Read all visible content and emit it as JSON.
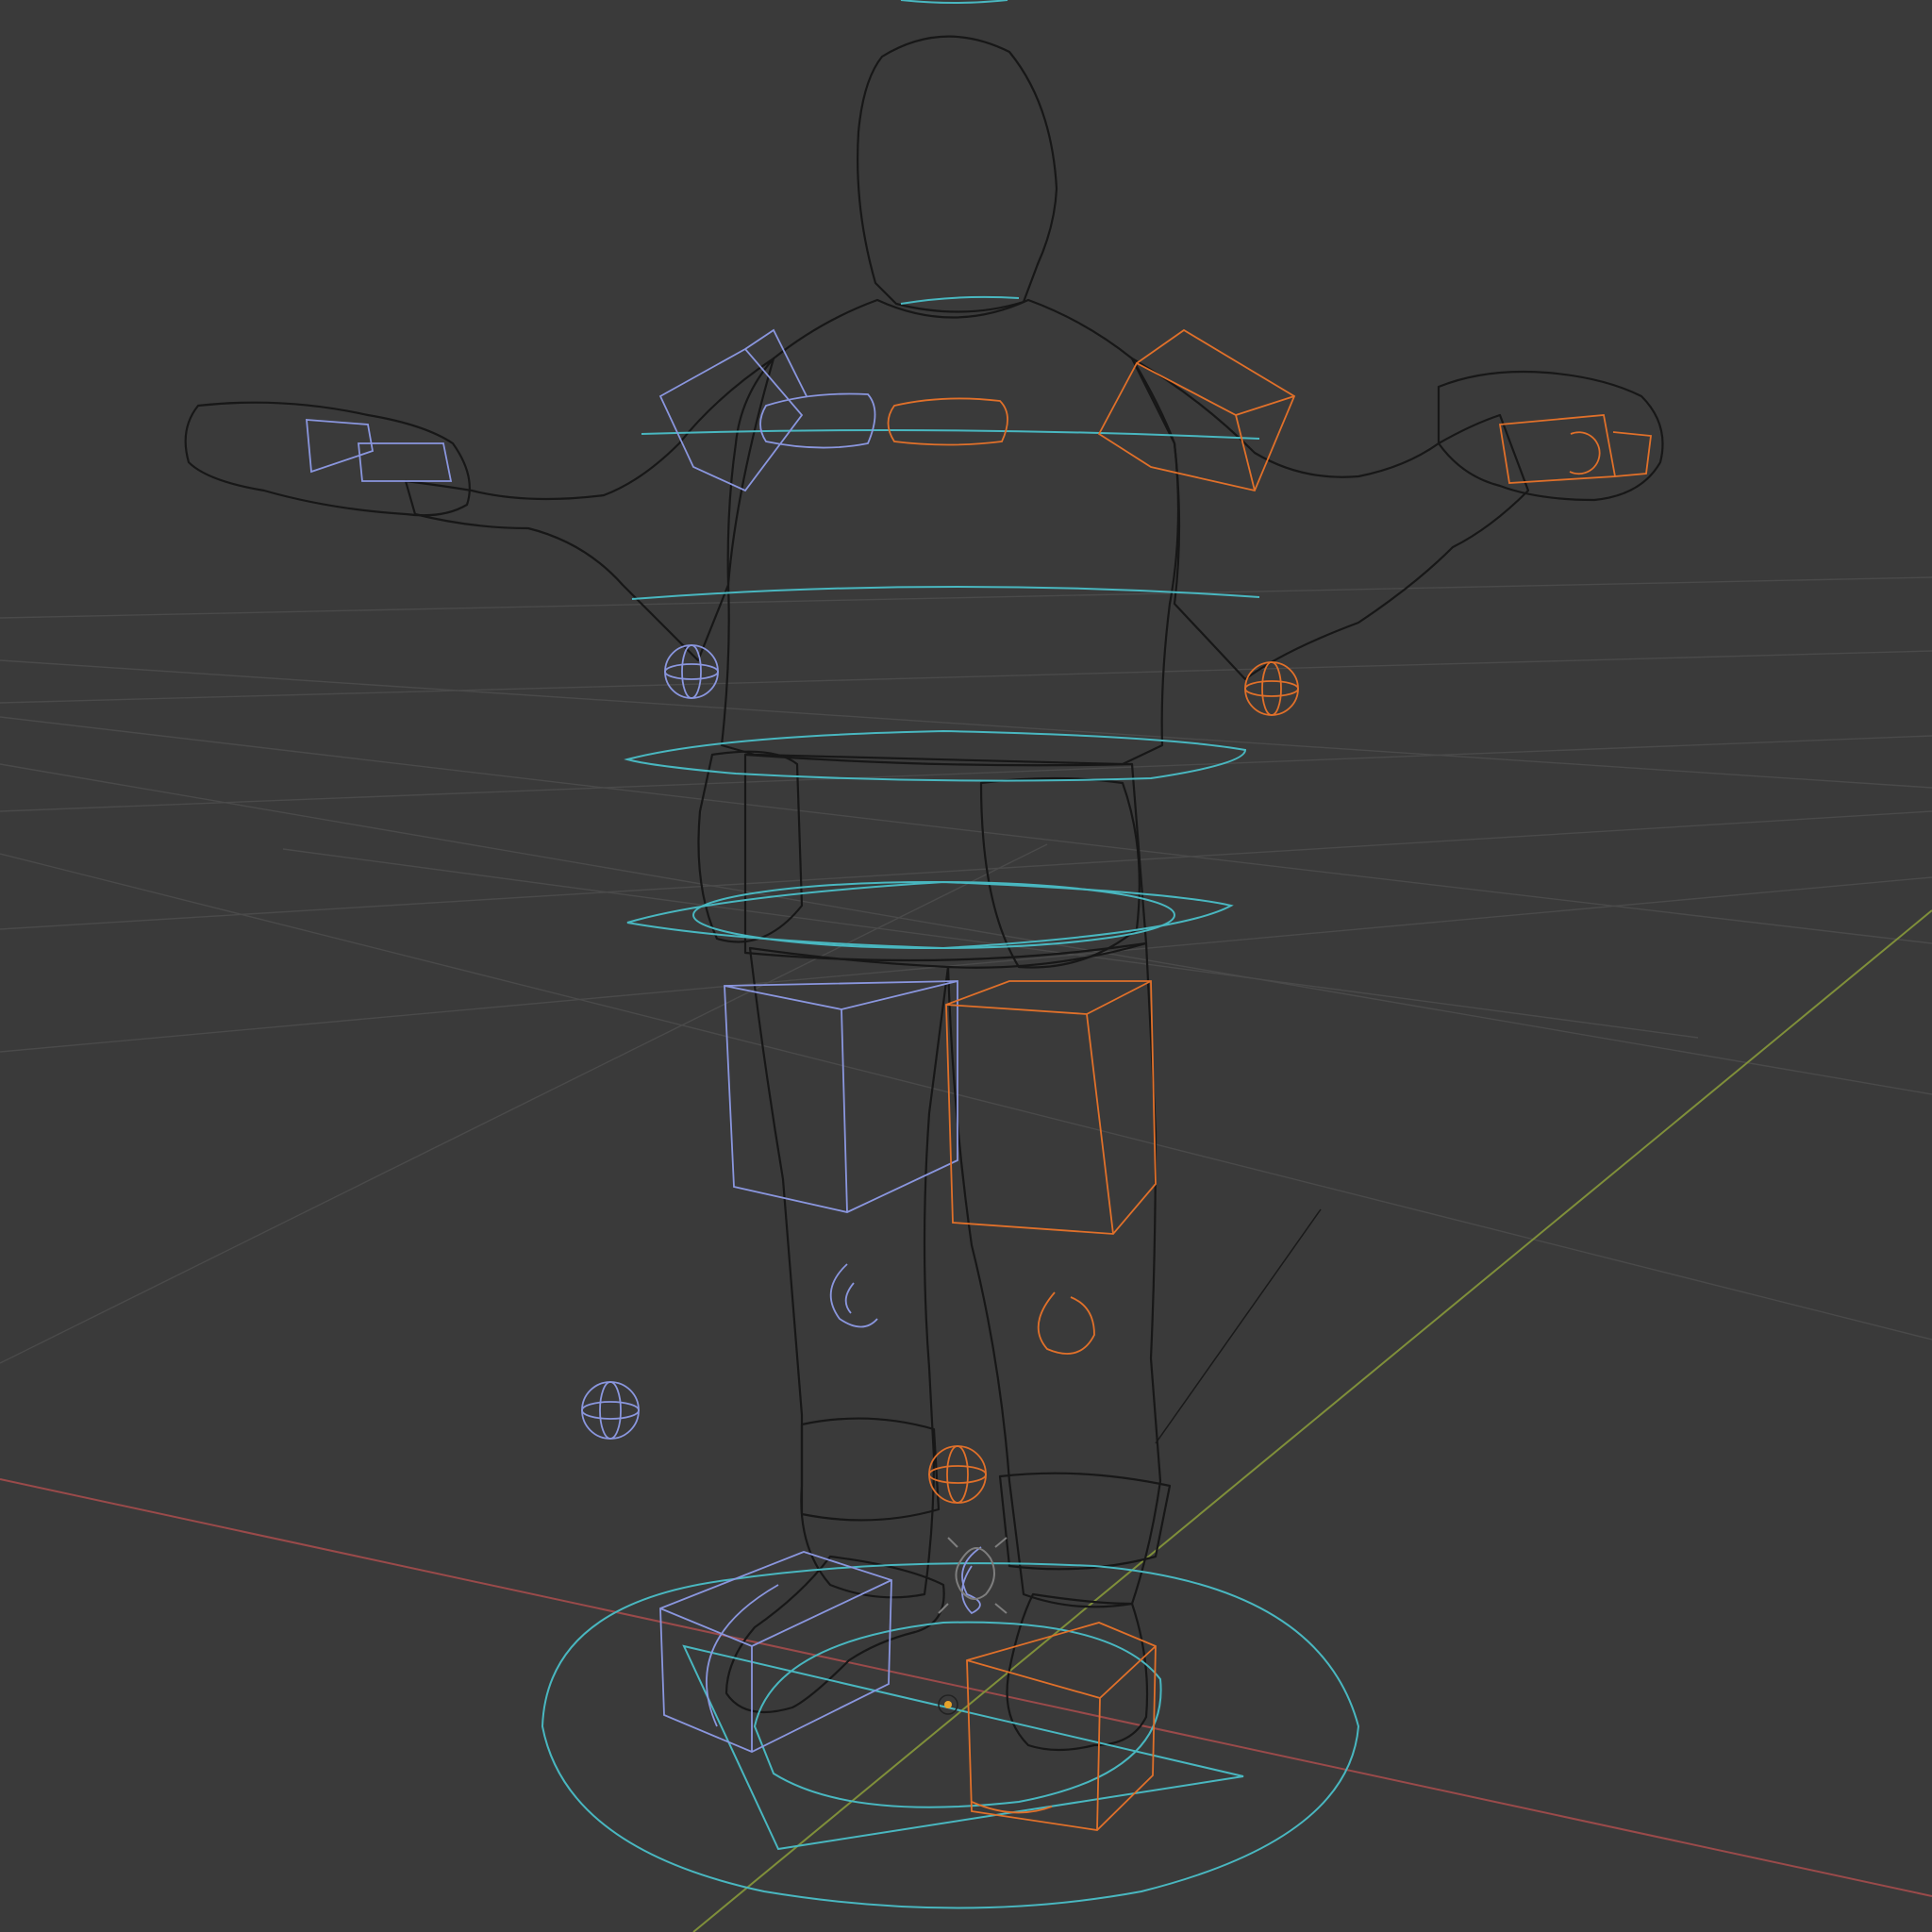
{
  "viewport": {
    "background": "#3a3a3a",
    "colors": {
      "grid": "#4a4a4a",
      "x_axis": "#9a4a4a",
      "y_axis": "#7f8f3a",
      "mesh_wire": "#171717",
      "control_cyan": "#49b7c0",
      "bone_left_blue": "#8a96de",
      "bone_right_orange": "#e0702a",
      "origin_dot": "#e7a32a"
    },
    "icons": {
      "origin": "origin-cursor-icon",
      "light": "light-gizmo-icon"
    }
  }
}
